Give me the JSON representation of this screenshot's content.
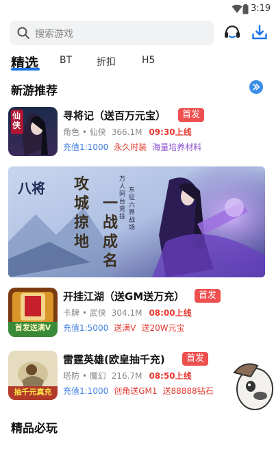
{
  "status_bar": {
    "time": "3:19"
  },
  "search": {
    "placeholder": "搜索游戏"
  },
  "tabs": [
    {
      "label": "精选"
    },
    {
      "label": "BT"
    },
    {
      "label": "折扣"
    },
    {
      "label": "H5"
    }
  ],
  "sections": {
    "new_games": {
      "title": "新游推荐"
    },
    "must_play": {
      "title": "精品必玩"
    }
  },
  "games": [
    {
      "name": "寻将记（送百万元宝）",
      "badge": "首发",
      "genre": "角色 • 仙侠",
      "size": "366.1M",
      "launch": "09:30上线",
      "tags": [
        "充值1:1000",
        "永久时装",
        "海量培养材料"
      ],
      "thumb_text": "仙侠"
    },
    {
      "name": "开挂江湖（送GM送万充）",
      "badge": "首发",
      "genre": "卡牌 • 武侠",
      "size": "304.1M",
      "launch": "08:00上线",
      "tags": [
        "充值1:5000",
        "送满V",
        "送20W元宝"
      ],
      "thumb_text": "首发送满V"
    },
    {
      "name": "雷霆英雄(欧皇抽千充)",
      "badge": "首发",
      "genre": "塔防 • 魔幻",
      "size": "216.7M",
      "launch": "08:50上线",
      "tags": [
        "充值1:1000",
        "创角送GM1",
        "送88888钻石"
      ],
      "thumb_text": "抽千元真充"
    }
  ],
  "banner": {
    "logo": "八将",
    "slogan_left": "攻城掠地",
    "slogan_right": "一战成名",
    "small_left": "万人同台竞技",
    "small_right": "东征六界战场"
  },
  "colors": {
    "accent": "#1a73e8",
    "badge": "#ee4f4f",
    "launch_red": "#e8382f",
    "tag_blue": "#3a7be0",
    "tag_red": "#e23a30",
    "tag_purple": "#8b4fd1"
  }
}
